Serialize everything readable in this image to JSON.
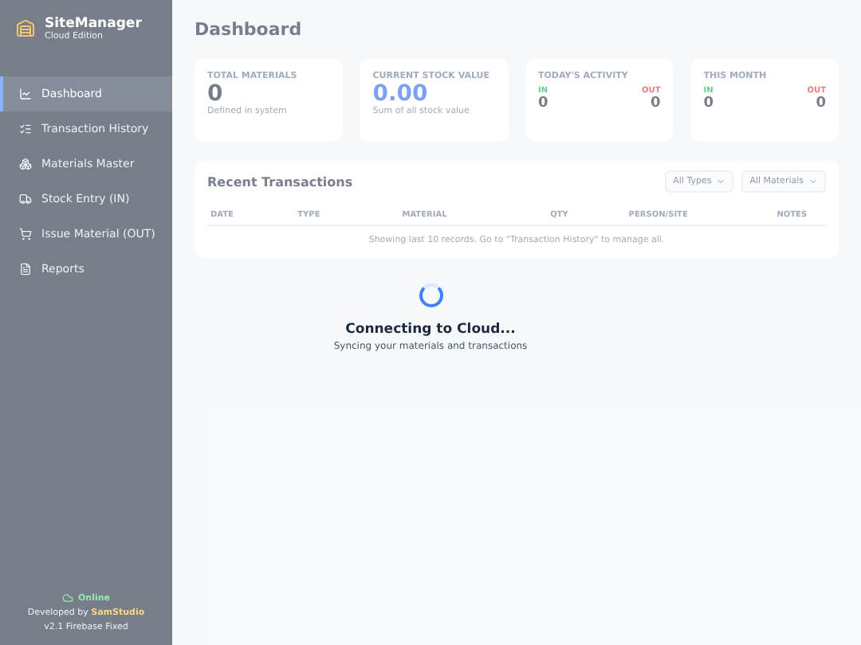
{
  "sidebar": {
    "brand": {
      "name": "SiteManager",
      "subtitle": "Cloud Edition"
    },
    "items": [
      {
        "label": "Dashboard",
        "selected": true
      },
      {
        "label": "Transaction History",
        "selected": false
      },
      {
        "label": "Materials Master",
        "selected": false
      },
      {
        "label": "Stock Entry (IN)",
        "selected": false
      },
      {
        "label": "Issue Material (OUT)",
        "selected": false
      },
      {
        "label": "Reports",
        "selected": false
      }
    ],
    "footer": {
      "status": "Online",
      "credit": "Developed by **SamStudio**",
      "version": "v2.1 Firebase Fixed"
    }
  },
  "page": {
    "title": "Dashboard"
  },
  "stats": [
    {
      "kind": "single",
      "label": "TOTAL MATERIALS",
      "value": "0",
      "caption": "Defined in system",
      "accent": false
    },
    {
      "kind": "single",
      "label": "CURRENT STOCK VALUE",
      "value": "0.00",
      "caption": "Sum of all stock value",
      "accent": true
    },
    {
      "kind": "split",
      "label": "TODAY'S ACTIVITY",
      "in_label": "IN",
      "out_label": "OUT",
      "in_value": "0",
      "out_value": "0"
    },
    {
      "kind": "split",
      "label": "THIS MONTH",
      "in_label": "IN",
      "out_label": "OUT",
      "in_value": "0",
      "out_value": "0"
    }
  ],
  "transactions": {
    "title": "Recent Transactions",
    "filters": [
      {
        "label": "All Types"
      },
      {
        "label": "All Materials"
      }
    ],
    "columns": [
      "DATE",
      "TYPE",
      "MATERIAL",
      "QTY",
      "PERSON/SITE",
      "NOTES"
    ],
    "empty_message": "Showing last 10 records. Go to \"Transaction History\" to manage all."
  },
  "loading": {
    "title": "Connecting to Cloud...",
    "message": "Syncing your materials and transactions"
  }
}
